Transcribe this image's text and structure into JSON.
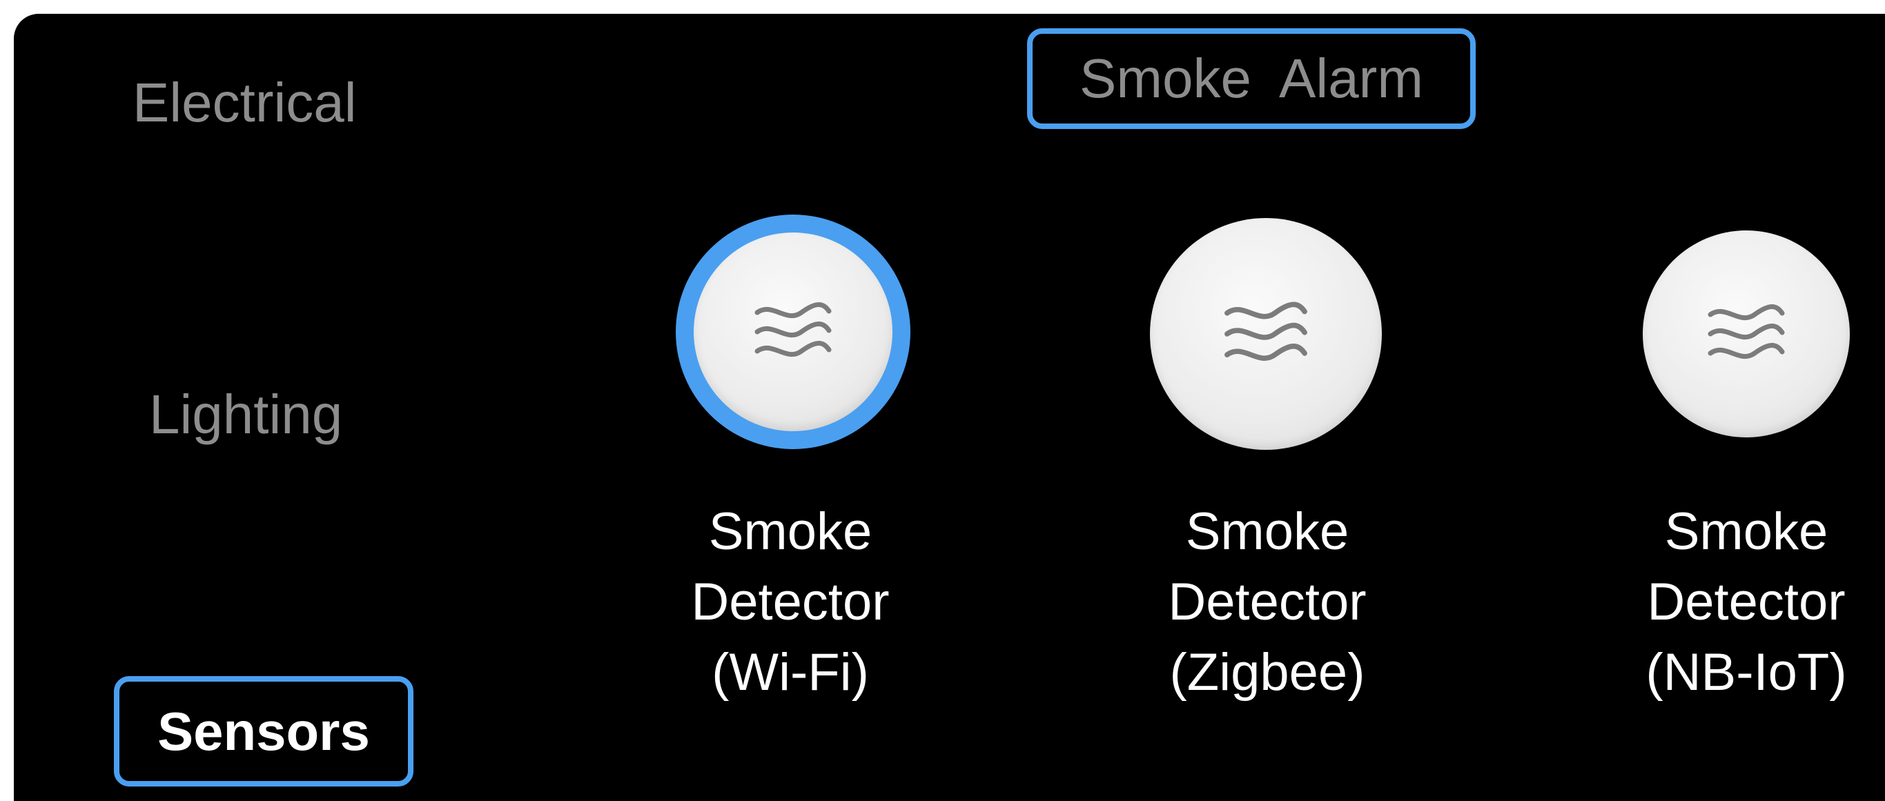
{
  "categories": {
    "electrical": "Electrical",
    "lighting": "Lighting",
    "sensors": "Sensors"
  },
  "section": {
    "title": "Smoke  Alarm"
  },
  "devices": [
    {
      "line1": "Smoke",
      "line2": "Detector",
      "line3": "(Wi-Fi)",
      "icon": "smoke-waves-icon",
      "selected": true
    },
    {
      "line1": "Smoke",
      "line2": "Detector",
      "line3": "(Zigbee)",
      "icon": "smoke-waves-icon",
      "selected": false
    },
    {
      "line1": "Smoke",
      "line2": "Detector",
      "line3": "(NB-IoT)",
      "icon": "smoke-waves-icon",
      "selected": false
    }
  ],
  "colors": {
    "accent": "#4a9ff0",
    "background": "#000000",
    "inactive_text": "#8d8d8d",
    "active_text": "#ffffff"
  }
}
